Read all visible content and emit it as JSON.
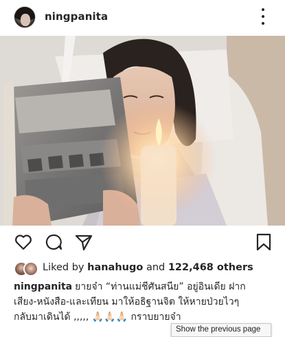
{
  "post": {
    "username": "ningpanita",
    "image_alt": "Woman reading a magazine by candlelight",
    "icons": {
      "like": "heart-icon",
      "comment": "comment-icon",
      "share": "send-icon",
      "save": "bookmark-icon",
      "more": "more-options-icon"
    },
    "likes": {
      "prefix": "Liked by",
      "user": "hanahugo",
      "connector": "and",
      "count": "122,468 others"
    },
    "caption": {
      "username": "ningpanita",
      "line1": "ยายจ๋า “ท่านแม่ชีศันสนีย” อยู่อินเดีย ฝาก",
      "line2": "เสียง-หนังสือ-และเทียน มาให้อธิฐานจิต ให้หายป่วยไวๆ",
      "line3": "กลับมาเดินได้ ,,,,, 🙏🏻🙏🏻🙏🏻 กราบยายจ๋า"
    }
  },
  "tooltip": {
    "text": "Show the previous page"
  }
}
